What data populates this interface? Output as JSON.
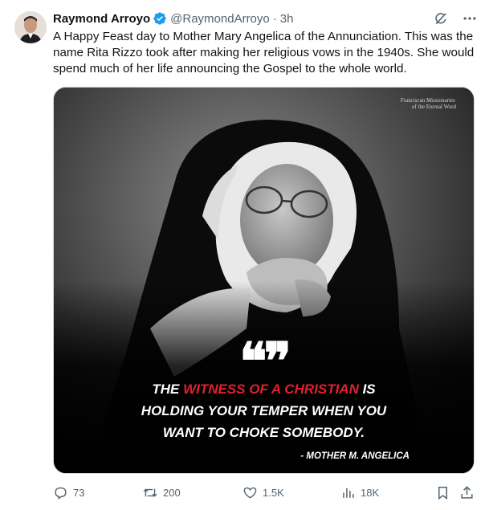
{
  "author": {
    "name": "Raymond Arroyo",
    "handle": "@RaymondArroyo",
    "separator": "·",
    "time": "3h"
  },
  "post": {
    "text": "A Happy Feast day to Mother Mary Angelica of the Annunciation. This was the name Rita Rizzo took after making her religious vows in the 1940s. She would spend much of her life announcing the Gospel to the whole world."
  },
  "media": {
    "watermark_line1": "Franciscan Missionaries",
    "watermark_line2": "of the Eternal Word",
    "quote_mark": "❝❞",
    "quote": {
      "line1_pre": "THE ",
      "line1_red": "WITNESS OF A CHRISTIAN",
      "line1_post": " IS",
      "line2": "HOLDING YOUR TEMPER WHEN YOU",
      "line3": "WANT TO CHOKE SOMEBODY."
    },
    "attribution": "- MOTHER M. ANGELICA",
    "accent_color": "#e0202e"
  },
  "actions": {
    "replies": "73",
    "reposts": "200",
    "likes": "1.5K",
    "views": "18K"
  },
  "icons": [
    "grok-icon",
    "more-icon",
    "reply-icon",
    "repost-icon",
    "like-icon",
    "views-icon",
    "bookmark-icon",
    "share-icon",
    "verified-badge-icon"
  ]
}
